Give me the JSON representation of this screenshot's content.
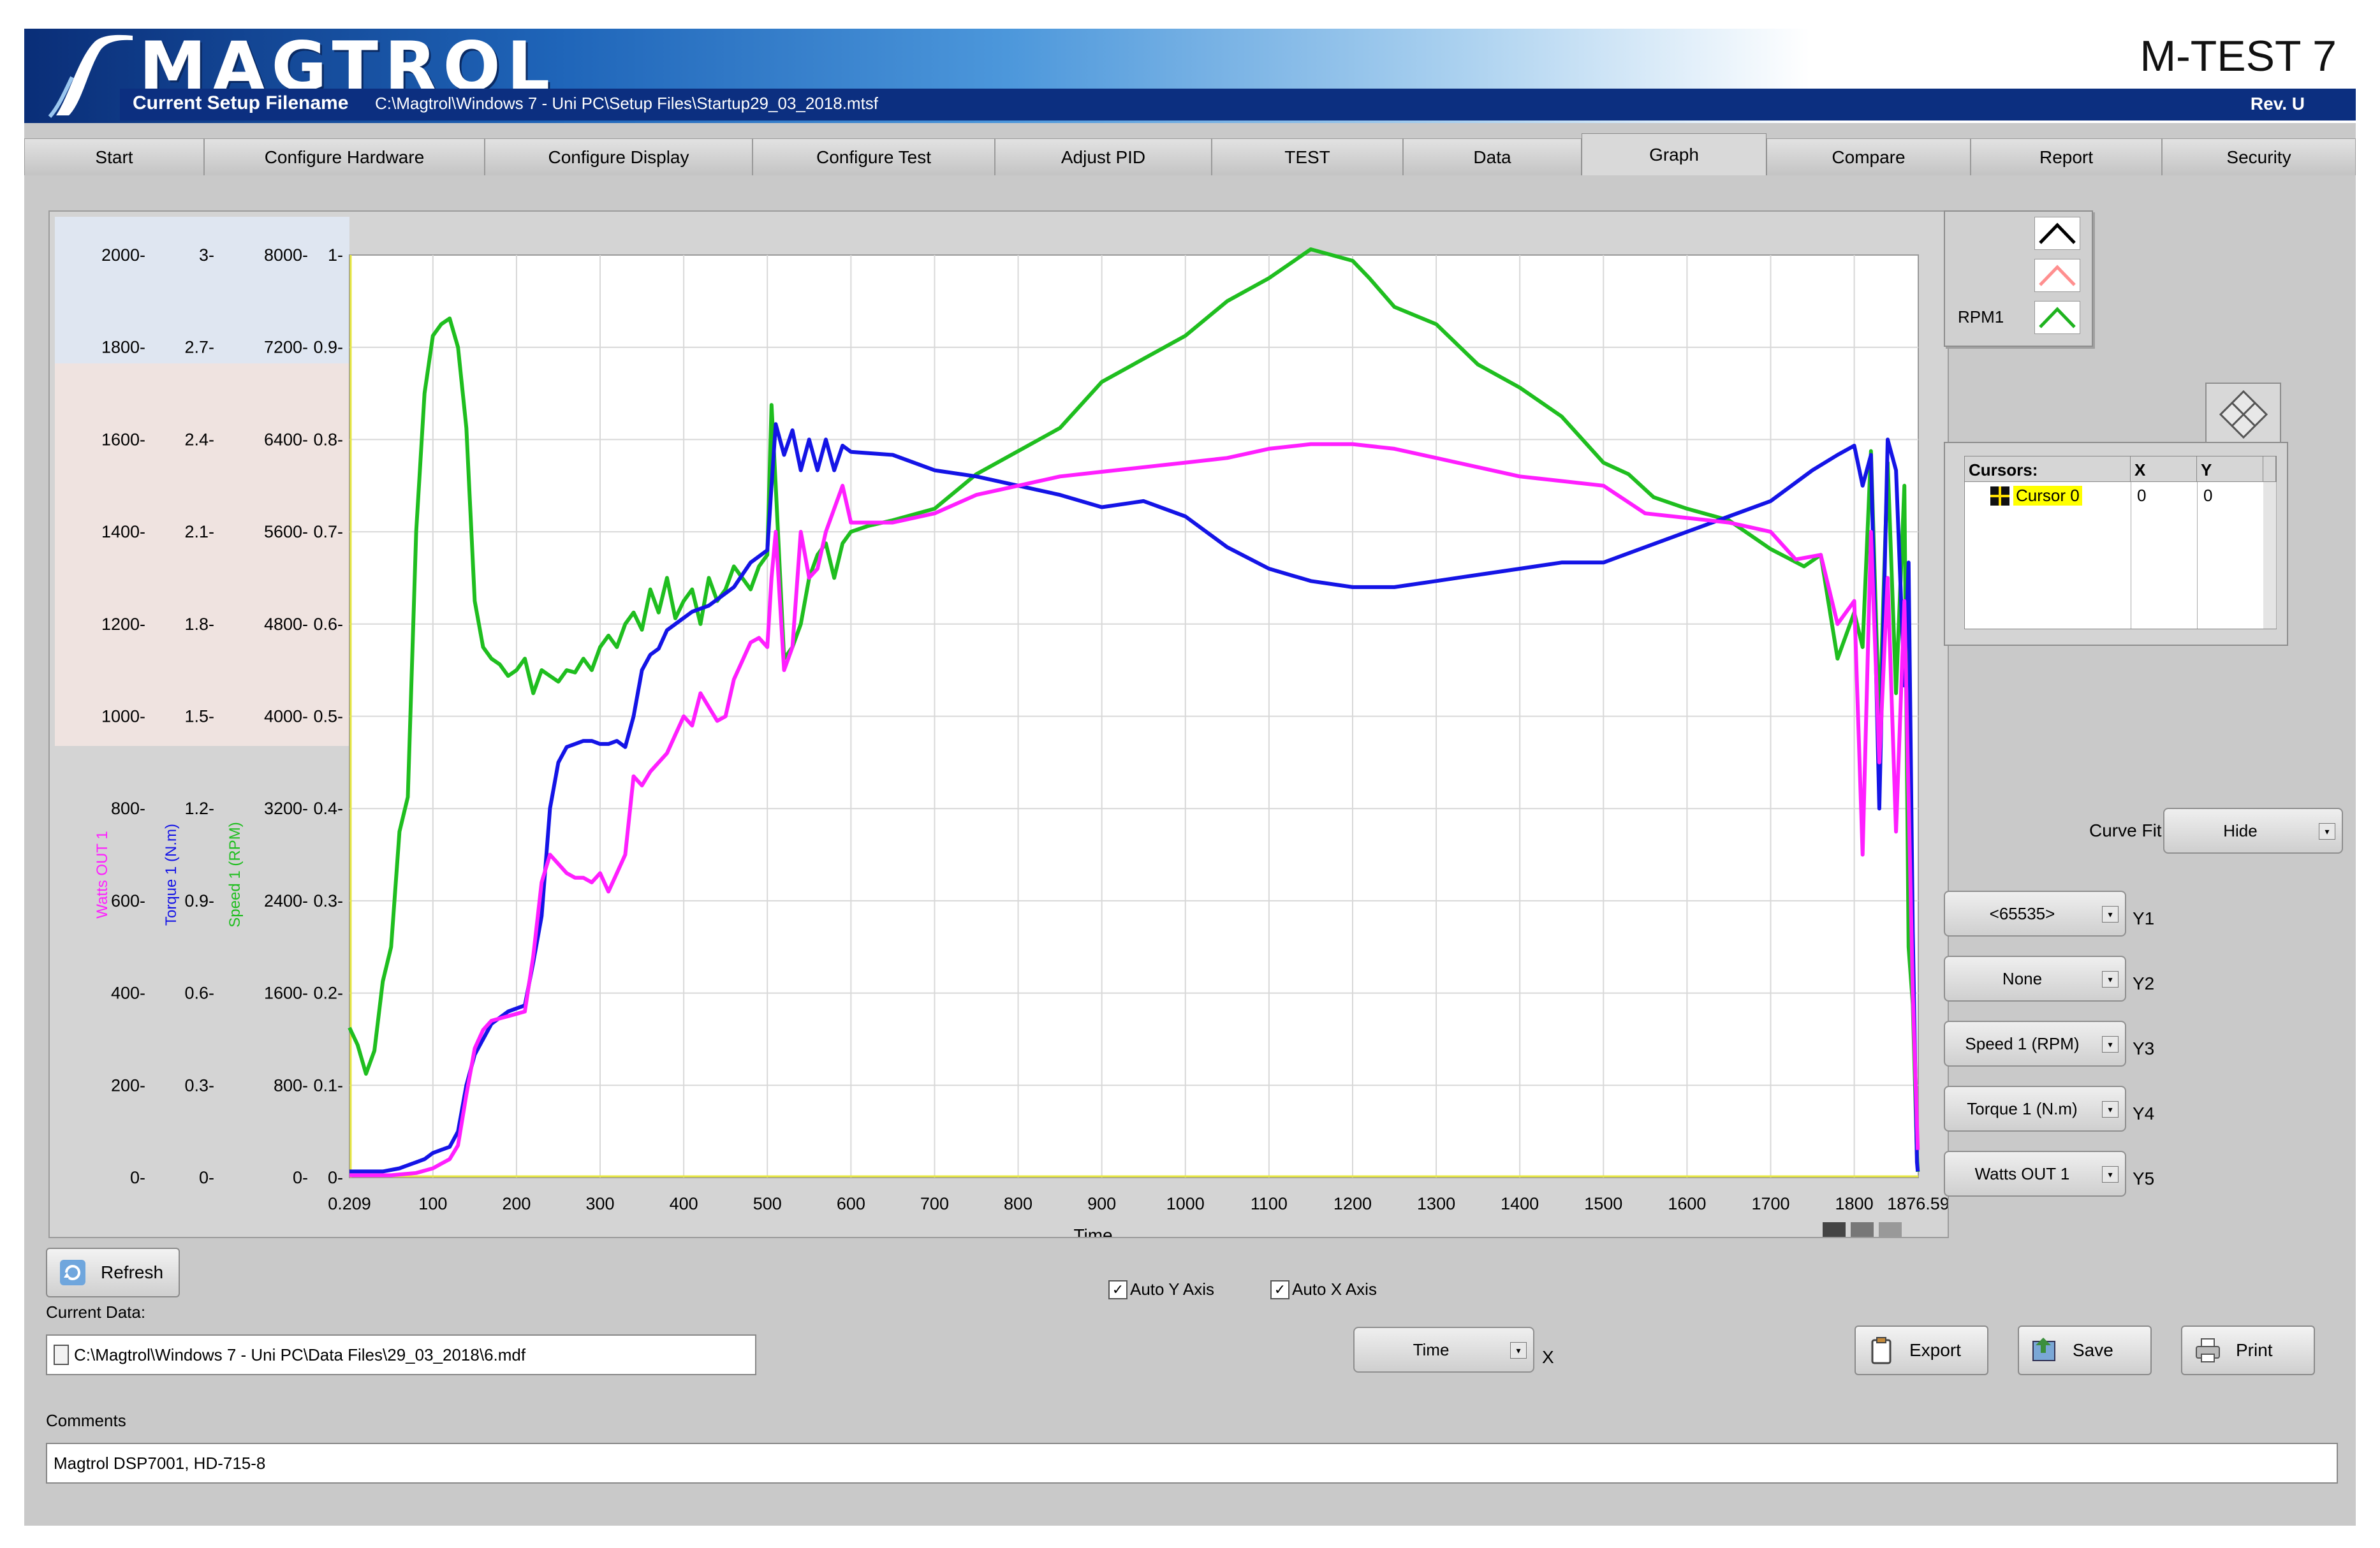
{
  "header": {
    "logo_text": "MAGTROL",
    "product": "M-TEST 7",
    "setup_label": "Current Setup Filename",
    "setup_path": "C:\\Magtrol\\Windows 7 - Uni PC\\Setup Files\\Startup29_03_2018.mtsf",
    "revision": "Rev. U"
  },
  "tabs": [
    {
      "label": "Start"
    },
    {
      "label": "Configure Hardware"
    },
    {
      "label": "Configure Display"
    },
    {
      "label": "Configure Test"
    },
    {
      "label": "Adjust PID"
    },
    {
      "label": "TEST"
    },
    {
      "label": "Data"
    },
    {
      "label": "Graph",
      "active": true
    },
    {
      "label": "Compare"
    },
    {
      "label": "Report"
    },
    {
      "label": "Security"
    }
  ],
  "legend": [
    {
      "name": "",
      "color": "#000000"
    },
    {
      "name": "",
      "color": "#ff8f8f"
    },
    {
      "name": "RPM1",
      "color": "#1fb31f"
    }
  ],
  "cursors": {
    "headers": [
      "Cursors:",
      "X",
      "Y"
    ],
    "rows": [
      {
        "name": "Cursor 0",
        "x": "0",
        "y": "0"
      }
    ]
  },
  "controls": {
    "curve_fit_label": "Curve Fit",
    "curve_fit_value": "Hide",
    "y_axes": [
      {
        "label": "Y1",
        "value": "<65535>"
      },
      {
        "label": "Y2",
        "value": "None"
      },
      {
        "label": "Y3",
        "value": "Speed 1 (RPM)"
      },
      {
        "label": "Y4",
        "value": "Torque 1 (N.m)"
      },
      {
        "label": "Y5",
        "value": "Watts OUT 1"
      }
    ],
    "x_axis_label": "X",
    "x_axis_value": "Time",
    "auto_y": "Auto Y Axis",
    "auto_x": "Auto X Axis",
    "refresh": "Refresh",
    "export": "Export",
    "save": "Save",
    "print": "Print"
  },
  "current_data": {
    "label": "Current Data:",
    "path": "C:\\Magtrol\\Windows 7 - Uni PC\\Data Files\\29_03_2018\\6.mdf"
  },
  "comments": {
    "label": "Comments",
    "value": "Magtrol DSP7001, HD-715-8"
  },
  "colors": {
    "watts": "#ff1fff",
    "torque": "#1414e6",
    "speed": "#1fbe1f",
    "band_blue": "#dfe6f1",
    "band_pink": "#efe3e0"
  },
  "chart_data": {
    "type": "line",
    "xlabel": "Time",
    "xlim": [
      0.209,
      1876.59
    ],
    "x_ticks": [
      "0.209",
      "100",
      "200",
      "300",
      "400",
      "500",
      "600",
      "700",
      "800",
      "900",
      "1000",
      "1100",
      "1200",
      "1300",
      "1400",
      "1500",
      "1600",
      "1700",
      "1800",
      "1876.59"
    ],
    "y_axes": [
      {
        "label": "Watts OUT 1",
        "color": "#ff1fff",
        "range": [
          0,
          2000
        ],
        "ticks": [
          "2000-",
          "1800-",
          "1600-",
          "1400-",
          "1200-",
          "1000-",
          "800-",
          "600-",
          "400-",
          "200-",
          "0-"
        ]
      },
      {
        "label": "Torque 1 (N.m)",
        "color": "#1414e6",
        "range": [
          0,
          3
        ],
        "ticks": [
          "3-",
          "2.7-",
          "2.4-",
          "2.1-",
          "1.8-",
          "1.5-",
          "1.2-",
          "0.9-",
          "0.6-",
          "0.3-",
          "0-"
        ]
      },
      {
        "label": "Speed 1 (RPM)",
        "color": "#1fbe1f",
        "range": [
          0,
          8000
        ],
        "ticks": [
          "8000-",
          "7200-",
          "6400-",
          "5600-",
          "4800-",
          "4000-",
          "3200-",
          "2400-",
          "1600-",
          "800-",
          "0-"
        ]
      },
      {
        "label": "",
        "color": "#000000",
        "range": [
          0,
          1
        ],
        "ticks": [
          "1-",
          "0.9-",
          "0.8-",
          "0.7-",
          "0.6-",
          "0.5-",
          "0.4-",
          "0.3-",
          "0.2-",
          "0.1-",
          "0-"
        ]
      }
    ],
    "series": [
      {
        "name": "Speed 1 (RPM)",
        "axis": "Speed 1 (RPM)",
        "color": "#1fbe1f",
        "x": [
          0.2,
          10,
          20,
          30,
          40,
          50,
          60,
          70,
          80,
          90,
          100,
          110,
          120,
          130,
          140,
          150,
          160,
          170,
          180,
          190,
          200,
          210,
          220,
          230,
          240,
          250,
          260,
          270,
          280,
          290,
          300,
          310,
          320,
          330,
          340,
          350,
          360,
          370,
          380,
          390,
          400,
          410,
          420,
          430,
          440,
          450,
          460,
          470,
          480,
          490,
          500,
          505,
          510,
          520,
          530,
          540,
          550,
          560,
          570,
          580,
          590,
          600,
          620,
          650,
          700,
          750,
          800,
          850,
          900,
          950,
          1000,
          1050,
          1100,
          1150,
          1200,
          1220,
          1250,
          1300,
          1350,
          1400,
          1450,
          1500,
          1530,
          1560,
          1600,
          1650,
          1700,
          1740,
          1760,
          1780,
          1800,
          1810,
          1820,
          1830,
          1840,
          1850,
          1860,
          1865,
          1870,
          1875,
          1876
        ],
        "y": [
          1300,
          1150,
          900,
          1100,
          1700,
          2000,
          3000,
          3300,
          5600,
          6800,
          7300,
          7400,
          7450,
          7200,
          6500,
          5000,
          4600,
          4500,
          4450,
          4350,
          4400,
          4500,
          4200,
          4400,
          4350,
          4300,
          4400,
          4380,
          4500,
          4400,
          4600,
          4700,
          4600,
          4800,
          4900,
          4750,
          5100,
          4900,
          5200,
          4850,
          5000,
          5100,
          4800,
          5200,
          5000,
          5100,
          5300,
          5200,
          5100,
          5300,
          5400,
          6700,
          6000,
          4500,
          4600,
          4800,
          5200,
          5400,
          5500,
          5200,
          5500,
          5600,
          5650,
          5700,
          5800,
          6100,
          6300,
          6500,
          6900,
          7100,
          7300,
          7600,
          7800,
          8050,
          7950,
          7800,
          7550,
          7400,
          7050,
          6850,
          6600,
          6200,
          6100,
          5900,
          5800,
          5700,
          5450,
          5300,
          5400,
          4500,
          4900,
          4600,
          6300,
          3900,
          6200,
          4200,
          6000,
          2000,
          1500,
          200,
          50
        ]
      },
      {
        "name": "Torque 1 (N.m)",
        "axis": "Torque 1 (N.m)",
        "color": "#1414e6",
        "x": [
          0.2,
          20,
          40,
          60,
          70,
          80,
          90,
          100,
          110,
          120,
          130,
          140,
          150,
          160,
          170,
          180,
          190,
          200,
          210,
          220,
          230,
          240,
          250,
          260,
          270,
          280,
          290,
          300,
          310,
          320,
          330,
          340,
          350,
          360,
          370,
          380,
          390,
          400,
          410,
          420,
          430,
          440,
          450,
          460,
          470,
          480,
          490,
          500,
          505,
          510,
          520,
          530,
          540,
          550,
          560,
          570,
          580,
          590,
          600,
          650,
          700,
          750,
          800,
          850,
          900,
          950,
          1000,
          1050,
          1100,
          1150,
          1200,
          1250,
          1300,
          1350,
          1400,
          1450,
          1500,
          1550,
          1600,
          1650,
          1700,
          1750,
          1780,
          1800,
          1810,
          1820,
          1830,
          1840,
          1850,
          1860,
          1865,
          1870,
          1875,
          1876
        ],
        "y": [
          0.02,
          0.02,
          0.02,
          0.03,
          0.04,
          0.05,
          0.06,
          0.08,
          0.09,
          0.1,
          0.15,
          0.3,
          0.4,
          0.45,
          0.5,
          0.52,
          0.54,
          0.55,
          0.56,
          0.7,
          0.85,
          1.2,
          1.35,
          1.4,
          1.41,
          1.42,
          1.42,
          1.41,
          1.41,
          1.42,
          1.4,
          1.5,
          1.65,
          1.7,
          1.72,
          1.78,
          1.8,
          1.82,
          1.84,
          1.85,
          1.86,
          1.88,
          1.9,
          1.92,
          1.96,
          2.0,
          2.02,
          2.04,
          2.25,
          2.45,
          2.35,
          2.43,
          2.3,
          2.4,
          2.3,
          2.4,
          2.3,
          2.38,
          2.36,
          2.35,
          2.3,
          2.28,
          2.25,
          2.22,
          2.18,
          2.2,
          2.15,
          2.05,
          1.98,
          1.94,
          1.92,
          1.92,
          1.94,
          1.96,
          1.98,
          2.0,
          2.0,
          2.05,
          2.1,
          2.15,
          2.2,
          2.3,
          2.35,
          2.38,
          2.25,
          2.35,
          1.2,
          2.4,
          2.3,
          1.6,
          2.0,
          0.8,
          0.05,
          0.02
        ]
      },
      {
        "name": "Watts OUT 1",
        "axis": "Watts OUT 1",
        "color": "#ff1fff",
        "x": [
          0.2,
          50,
          80,
          100,
          110,
          120,
          130,
          140,
          150,
          160,
          170,
          180,
          190,
          200,
          210,
          220,
          230,
          240,
          250,
          260,
          270,
          280,
          290,
          300,
          310,
          320,
          330,
          340,
          350,
          360,
          370,
          380,
          390,
          400,
          410,
          420,
          430,
          440,
          450,
          460,
          470,
          480,
          490,
          500,
          505,
          510,
          520,
          530,
          540,
          550,
          560,
          570,
          580,
          590,
          600,
          650,
          700,
          750,
          800,
          850,
          900,
          950,
          1000,
          1050,
          1100,
          1150,
          1200,
          1250,
          1300,
          1350,
          1400,
          1450,
          1500,
          1550,
          1600,
          1650,
          1700,
          1730,
          1760,
          1780,
          1800,
          1810,
          1820,
          1830,
          1840,
          1850,
          1860,
          1870,
          1876
        ],
        "y": [
          5,
          5,
          10,
          20,
          30,
          40,
          70,
          180,
          280,
          320,
          340,
          345,
          350,
          355,
          360,
          480,
          640,
          700,
          680,
          660,
          650,
          650,
          640,
          660,
          620,
          660,
          700,
          870,
          850,
          880,
          900,
          920,
          960,
          1000,
          980,
          1050,
          1020,
          990,
          1000,
          1080,
          1120,
          1160,
          1170,
          1150,
          1300,
          1400,
          1100,
          1150,
          1400,
          1300,
          1320,
          1400,
          1450,
          1500,
          1420,
          1420,
          1440,
          1480,
          1500,
          1520,
          1530,
          1540,
          1550,
          1560,
          1580,
          1590,
          1590,
          1580,
          1560,
          1540,
          1520,
          1510,
          1500,
          1440,
          1430,
          1420,
          1400,
          1340,
          1350,
          1200,
          1250,
          700,
          1400,
          900,
          1300,
          750,
          1250,
          400,
          60
        ]
      }
    ]
  }
}
